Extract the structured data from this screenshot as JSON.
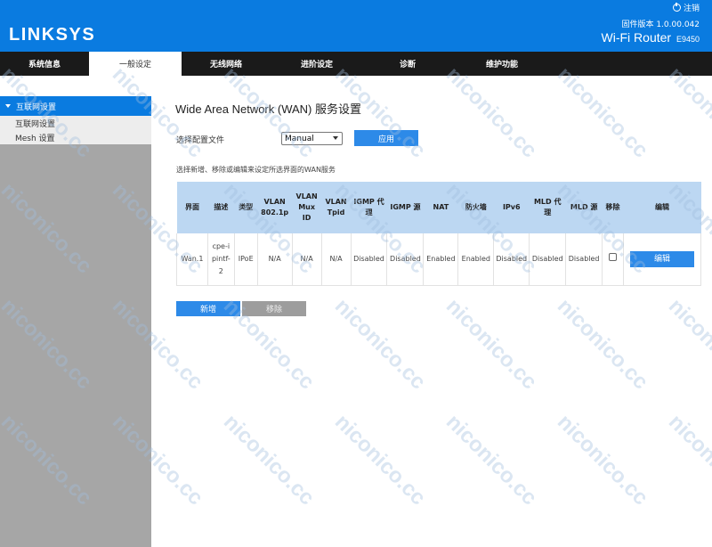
{
  "header": {
    "brand": "LINKSYS",
    "logout_label": "注销",
    "firmware": "固件版本 1.0.00.042",
    "router_name": "Wi-Fi Router",
    "router_model": "E9450",
    "bg_color": "#0a7be0"
  },
  "nav": {
    "tabs": [
      {
        "label": "系统信息",
        "active": false
      },
      {
        "label": "一般设定",
        "active": true
      },
      {
        "label": "无线网络",
        "active": false
      },
      {
        "label": "进阶设定",
        "active": false
      },
      {
        "label": "诊断",
        "active": false
      },
      {
        "label": "维护功能",
        "active": false
      }
    ]
  },
  "sidebar": {
    "section_label": "互联网设置",
    "items": [
      {
        "label": "互联网设置"
      },
      {
        "label": "Mesh 设置"
      }
    ]
  },
  "main": {
    "title": "Wide Area Network (WAN) 服务设置",
    "profile_label": "选择配置文件",
    "profile_value": "Manual",
    "apply_label": "应用",
    "instructions": "选择新增、移除或编辑来设定所选界面的WAN服务",
    "table": {
      "headers": [
        "界面",
        "描述",
        "类型",
        "VLAN 802.1p",
        "VLAN Mux ID",
        "VLAN Tpid",
        "IGMP 代理",
        "IGMP 源",
        "NAT",
        "防火墙",
        "IPv6",
        "MLD 代理",
        "MLD 源",
        "移除",
        "编辑"
      ],
      "rows": [
        {
          "interface": "Wan.1",
          "description": "cpe-ipintf-2",
          "type": "IPoE",
          "vlan_8021p": "N/A",
          "vlan_mux_id": "N/A",
          "vlan_tpid": "N/A",
          "igmp_proxy": "Disabled",
          "igmp_source": "Disabled",
          "nat": "Enabled",
          "firewall": "Enabled",
          "ipv6": "Disabled",
          "mld_proxy": "Disabled",
          "mld_source": "Disabled",
          "remove_checked": false,
          "edit_label": "编辑"
        }
      ]
    },
    "add_label": "新增",
    "remove_label": "移除"
  },
  "watermark": "niconico.cc"
}
